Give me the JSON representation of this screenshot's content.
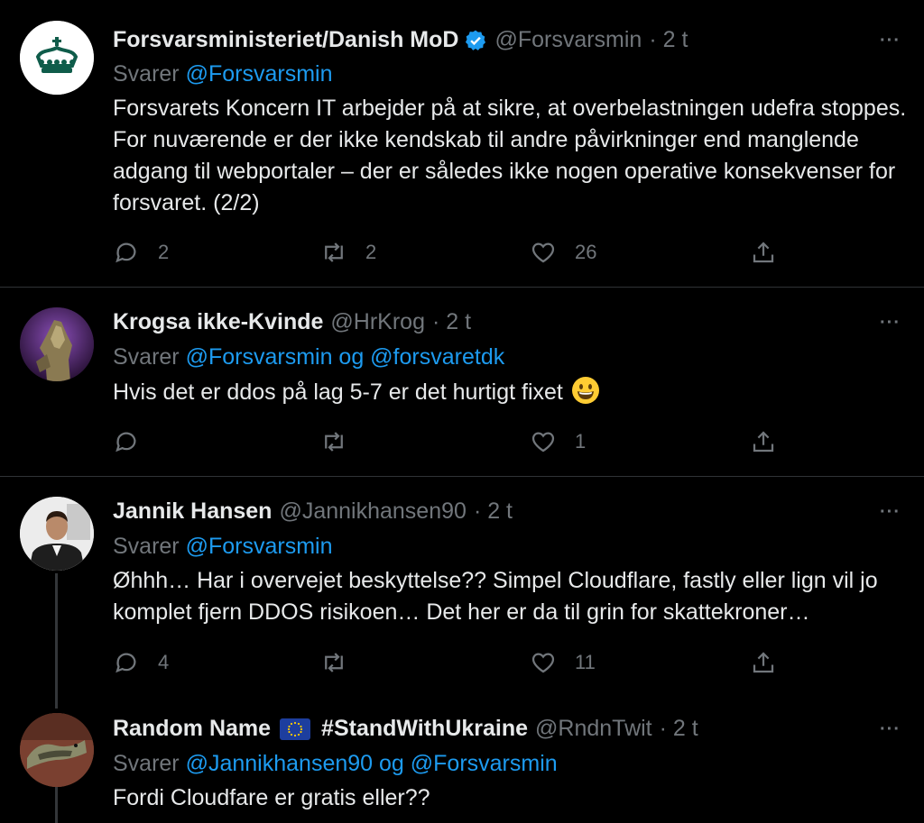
{
  "tweets": [
    {
      "name": "Forsvarsministeriet/Danish MoD",
      "handle": "@Forsvarsmin",
      "time": "· 2 t",
      "verified": true,
      "reply_prefix": "Svarer",
      "reply_to": "@Forsvarsmin",
      "text": "Forsvarets Koncern IT arbejder på at sikre, at overbelastningen udefra stoppes. For nuværende er der ikke kendskab til andre påvirkninger end manglende adgang til webportaler – der er således ikke nogen operative konsekvenser for forsvaret. (2/2)",
      "replies": "2",
      "retweets": "2",
      "likes": "26"
    },
    {
      "name": "Krogsa ikke-Kvinde",
      "handle": "@HrKrog",
      "time": "· 2 t",
      "reply_prefix": "Svarer",
      "reply_to": "@Forsvarsmin og @forsvaretdk",
      "text": "Hvis det er ddos på lag 5-7 er det hurtigt fixet",
      "emoji": "grinning-face",
      "replies": "",
      "retweets": "",
      "likes": "1"
    },
    {
      "name": "Jannik Hansen",
      "handle": "@Jannikhansen90",
      "time": "· 2 t",
      "reply_prefix": "Svarer",
      "reply_to": "@Forsvarsmin",
      "text": "Øhhh… Har i overvejet beskyttelse?? Simpel Cloudflare, fastly eller lign vil jo komplet fjern DDOS risikoen… Det her er da til grin for skattekroner…",
      "replies": "4",
      "retweets": "",
      "likes": "11"
    },
    {
      "name": "Random Name",
      "flag": "eu-flag",
      "name_suffix": "#StandWithUkraine",
      "handle": "@RndnTwit",
      "time": "· 2 t",
      "reply_prefix": "Svarer",
      "reply_to": "@Jannikhansen90 og @Forsvarsmin",
      "text": "Fordi Cloudfare er gratis eller??"
    }
  ],
  "more_label": "···",
  "colors": {
    "background": "#000000",
    "text": "#e7e9ea",
    "muted": "#71767b",
    "link": "#1d9bf0",
    "divider": "#2f3336",
    "verified": "#1d9bf0"
  }
}
